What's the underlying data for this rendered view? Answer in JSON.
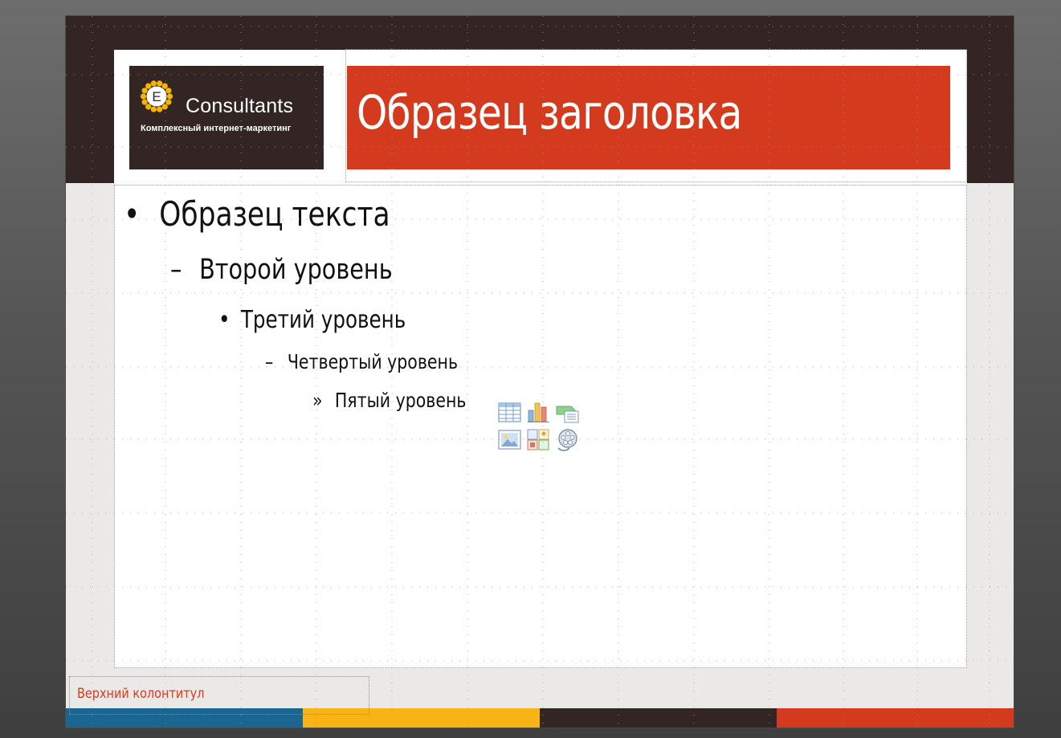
{
  "logo": {
    "letter": "E",
    "name": "Consultants",
    "tagline": "Комплексный интернет-маркетинг"
  },
  "title": {
    "text": "Образец заголовка"
  },
  "body": {
    "levels": [
      {
        "marker": "•",
        "text": "Образец текста"
      },
      {
        "marker": "–",
        "text": "Второй уровень"
      },
      {
        "marker": "•",
        "text": "Третий уровень"
      },
      {
        "marker": "–",
        "text": "Четвертый уровень"
      },
      {
        "marker": "»",
        "text": "Пятый уровень"
      }
    ]
  },
  "insert_icons": [
    "table-icon",
    "chart-icon",
    "smartart-icon",
    "picture-icon",
    "clipart-icon",
    "media-icon"
  ],
  "footer": {
    "text": "Верхний колонтитул"
  },
  "colors": {
    "dark_brown": "#322523",
    "accent_red": "#d43a1d",
    "slide_gray": "#ebe9e7",
    "strip": [
      "#1b6591",
      "#f8b415",
      "#322523",
      "#d43a1d"
    ],
    "sun_yellow": "#f4b400"
  }
}
